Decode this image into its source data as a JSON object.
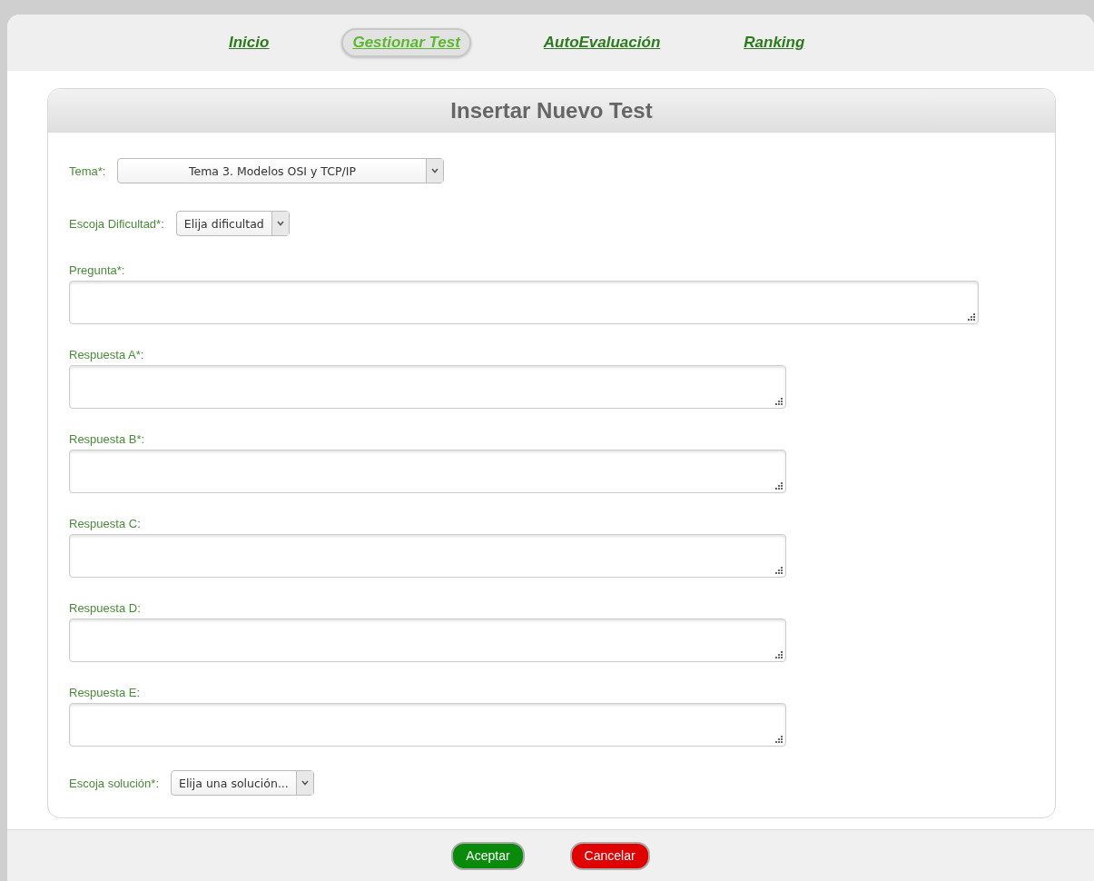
{
  "nav": [
    {
      "label": "Inicio",
      "selected": false
    },
    {
      "label": "Gestionar Test",
      "selected": true
    },
    {
      "label": "AutoEvaluación",
      "selected": false
    },
    {
      "label": "Ranking",
      "selected": false
    }
  ],
  "panel": {
    "title": "Insertar Nuevo Test"
  },
  "fields": [
    {
      "kind": "wideselect",
      "label": "Tema*:",
      "value": "Tema 3. Modelos OSI y TCP/IP"
    },
    {
      "kind": "select",
      "label": "Escoja Dificultad*:",
      "value": "Elija dificultad"
    },
    {
      "kind": "widetextarea",
      "label": "Pregunta*:"
    },
    {
      "kind": "textarea",
      "label": "Respuesta A*:"
    },
    {
      "kind": "textarea",
      "label": "Respuesta B*:"
    },
    {
      "kind": "textarea",
      "label": "Respuesta C:"
    },
    {
      "kind": "textarea",
      "label": "Respuesta D:"
    },
    {
      "kind": "textarea",
      "label": "Respuesta E:"
    },
    {
      "kind": "select",
      "label": "Escoja solución*:",
      "value": "Elija una solución..."
    }
  ],
  "buttons": [
    {
      "label": "Aceptar",
      "kind": "accept"
    },
    {
      "label": "Cancelar",
      "kind": "cancel"
    }
  ]
}
